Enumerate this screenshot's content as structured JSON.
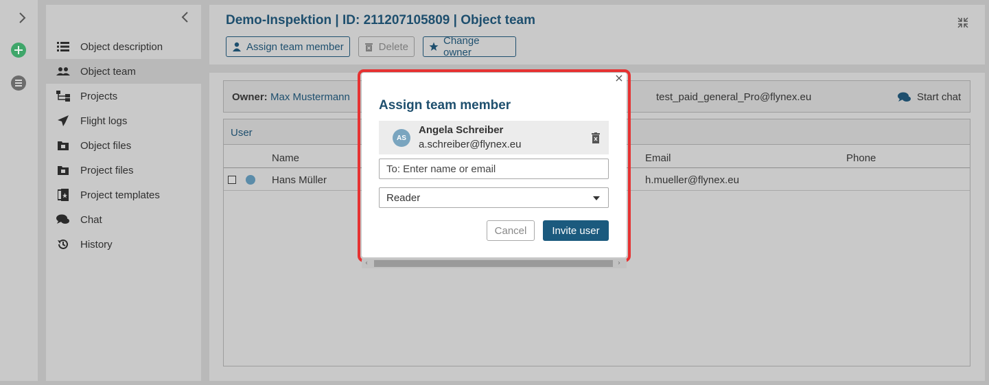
{
  "rail": {
    "icons": [
      "chevron-right-icon",
      "add-circle-icon",
      "list-circle-icon"
    ],
    "colors": {
      "add": "#3fa66a"
    }
  },
  "nav": {
    "items": [
      {
        "label": "Object description",
        "icon": "list-icon"
      },
      {
        "label": "Object team",
        "icon": "team-icon",
        "active": true
      },
      {
        "label": "Projects",
        "icon": "sitemap-icon"
      },
      {
        "label": "Flight logs",
        "icon": "plane-icon"
      },
      {
        "label": "Object files",
        "icon": "folder-icon"
      },
      {
        "label": "Project files",
        "icon": "folder-icon"
      },
      {
        "label": "Project templates",
        "icon": "templates-icon"
      },
      {
        "label": "Chat",
        "icon": "chat-icon"
      },
      {
        "label": "History",
        "icon": "history-icon"
      }
    ]
  },
  "header": {
    "title": "Demo-Inspektion | ID: 211207105809 | Object team",
    "buttons": {
      "assign": "Assign team member",
      "delete": "Delete",
      "change_owner": "Change owner"
    }
  },
  "owner": {
    "label": "Owner:",
    "name": "Max Mustermann",
    "email": "test_paid_general_Pro@flynex.eu",
    "chat": "Start chat"
  },
  "table": {
    "tab": "User",
    "columns": [
      "Name",
      "Email",
      "Phone"
    ],
    "rows": [
      {
        "name": "Hans Müller",
        "email": "h.mueller@flynex.eu",
        "phone": ""
      }
    ]
  },
  "modal": {
    "title": "Assign team member",
    "selected_user": {
      "initials": "AS",
      "name": "Angela Schreiber",
      "email": "a.schreiber@flynex.eu"
    },
    "input_placeholder": "To: Enter name or email",
    "role": "Reader",
    "cancel": "Cancel",
    "invite": "Invite user"
  },
  "colors": {
    "accent": "#1e4f6e",
    "primary_button": "#1b5a7e",
    "highlight": "#e63232"
  }
}
